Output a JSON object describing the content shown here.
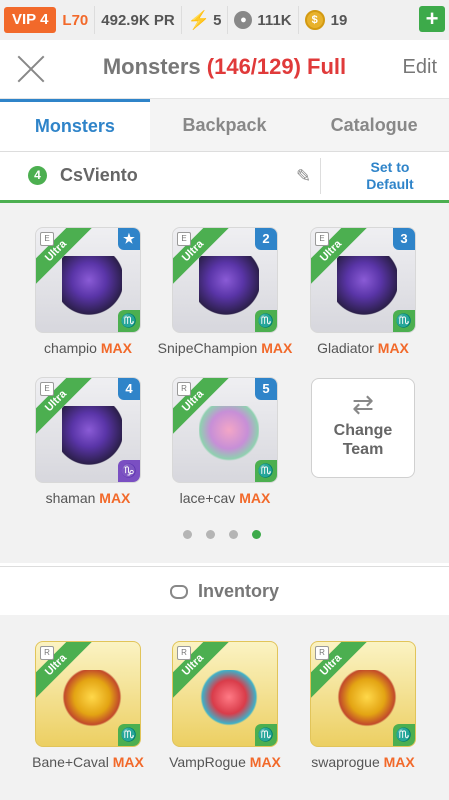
{
  "status": {
    "vip": "VIP 4",
    "level": "L70",
    "power": "492.9K PR",
    "energy": "5",
    "food": "111K",
    "gems": "19",
    "add_label": "+"
  },
  "header": {
    "title": "Monsters",
    "count": "(146/129) Full",
    "edit_label": "Edit"
  },
  "tabs": [
    "Monsters",
    "Backpack",
    "Catalogue"
  ],
  "team": {
    "number": "4",
    "name": "CsViento",
    "set_default": "Set to Default"
  },
  "team_monsters": [
    {
      "name": "champio",
      "max": "MAX",
      "slot": "★",
      "tier": "Ultra",
      "rarity": "E",
      "element": "♏"
    },
    {
      "name": "SnipeChampion",
      "max": "MAX",
      "slot": "2",
      "tier": "Ultra",
      "rarity": "E",
      "element": "♏"
    },
    {
      "name": "Gladiator",
      "max": "MAX",
      "slot": "3",
      "tier": "Ultra",
      "rarity": "E",
      "element": "♏"
    },
    {
      "name": "shaman",
      "max": "MAX",
      "slot": "4",
      "tier": "Ultra",
      "rarity": "E",
      "element": "♑"
    },
    {
      "name": "lace+cav",
      "max": "MAX",
      "slot": "5",
      "tier": "Ultra",
      "rarity": "R",
      "element": "♏"
    }
  ],
  "change_team": "Change Team",
  "inventory_title": "Inventory",
  "inventory_monsters": [
    {
      "name": "Bane+Caval",
      "max": "MAX",
      "tier": "Ultra",
      "rarity": "R",
      "element": "♏"
    },
    {
      "name": "VampRogue",
      "max": "MAX",
      "tier": "Ultra",
      "rarity": "R",
      "element": "♏"
    },
    {
      "name": "swaprogue",
      "max": "MAX",
      "tier": "Ultra",
      "rarity": "R",
      "element": "♏"
    }
  ],
  "colors": {
    "accent_blue": "#2f84c9",
    "green": "#4caf50",
    "orange": "#f2692a",
    "red": "#e03a3a"
  }
}
